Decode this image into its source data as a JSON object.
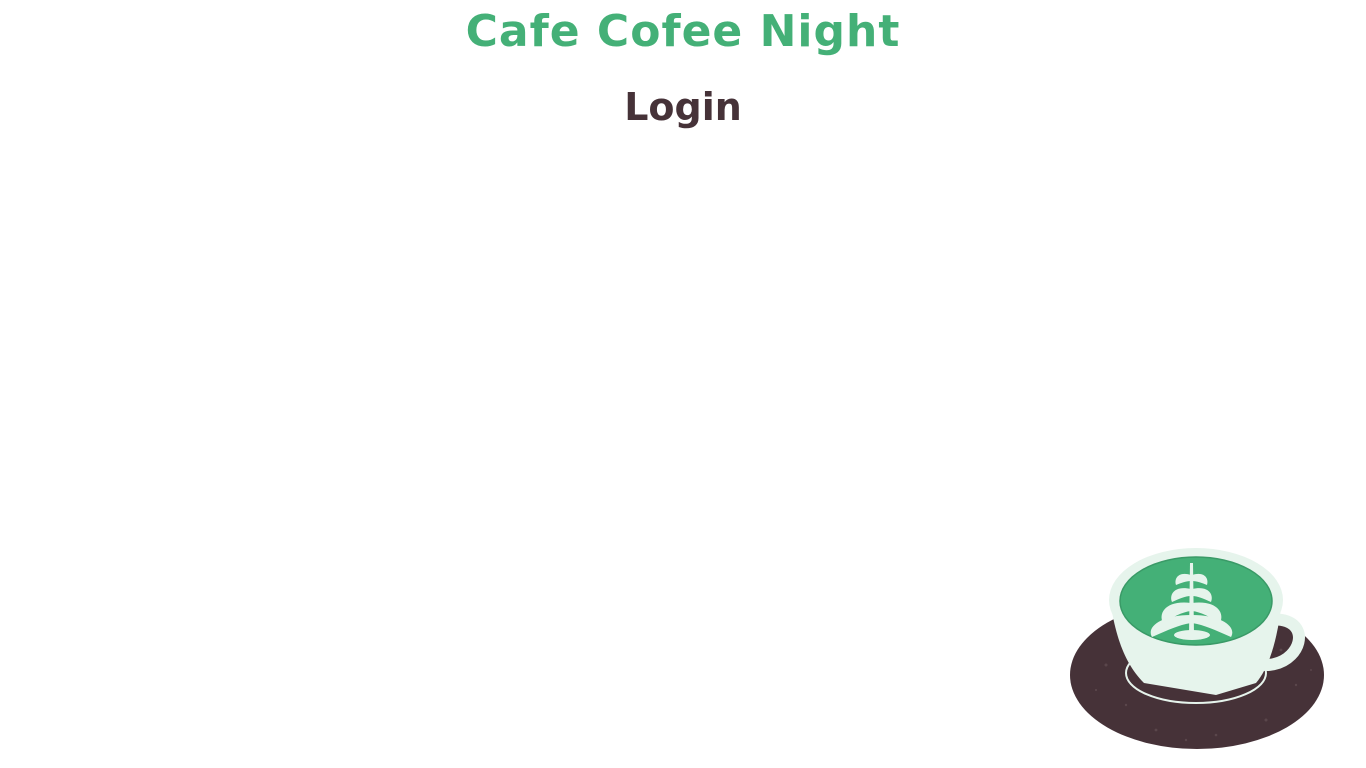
{
  "header": {
    "app_title": "Cafe Cofee Night",
    "page_title": "Login"
  },
  "illustration": {
    "icon": "coffee-cup-illustration",
    "colors": {
      "saucer": "#463238",
      "cup": "#e6f4ec",
      "coffee": "#44b077",
      "latte_art": "#e6f4ec"
    }
  },
  "theme": {
    "accent": "#44b077",
    "dark": "#463238",
    "background": "#ffffff"
  }
}
